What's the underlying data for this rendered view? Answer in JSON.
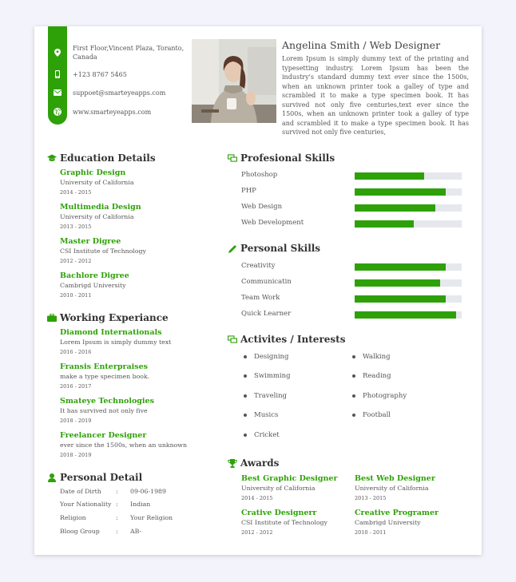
{
  "contact": {
    "address": "First Floor,Vincent Plaza, Toranto, Canada",
    "phone": "+123 8767 5465",
    "email": "suppoet@smarteyeapps.com",
    "website": "www.smarteyeapps.com"
  },
  "profile": {
    "name": "Angelina Smith / Web Designer",
    "bio": "Lorem Ipsum is simply dummy text of the printing and typesetting industry. Lorem Ipsum has been the industry's standard dummy text ever since the 1500s, when an unknown printer took a galley of type and scrambled it to make a type specimen book. It has survived not only five centuries,text ever since the 1500s, when an unknown printer took a galley of type and scrambled it to make a type specimen book. It has survived not only five centuries,"
  },
  "education": {
    "title": "Education Details",
    "items": [
      {
        "title": "Graphic Design",
        "school": "University of California",
        "years": "2014 - 2015"
      },
      {
        "title": "Multimedia Design",
        "school": "University of California",
        "years": "2013 - 2015"
      },
      {
        "title": "Master Digree",
        "school": "CSI Institute of Technology",
        "years": "2012 - 2012"
      },
      {
        "title": "Bachlore Digree",
        "school": "Cambrigd University",
        "years": "2010 - 2011"
      }
    ]
  },
  "experience": {
    "title": "Working Experiance",
    "items": [
      {
        "title": "Diamond Internationals",
        "desc": "Lorem Ipsum is simply dummy text",
        "years": "2016 - 2016"
      },
      {
        "title": "Fransis Enterpraises",
        "desc": "make a type specimen book.",
        "years": "2016 - 2017"
      },
      {
        "title": "Smateye Technologies",
        "desc": "It has survived not only five",
        "years": "2018 - 2019"
      },
      {
        "title": "Freelancer Designer",
        "desc": "ever since the 1500s, when an unknown",
        "years": "2018 - 2019"
      }
    ]
  },
  "personal_detail": {
    "title": "Personal Detail",
    "rows": [
      {
        "key": "Date of Dirth",
        "sep": ":",
        "value": "09-06-1989"
      },
      {
        "key": "Your Nationality",
        "sep": ":",
        "value": "Indian"
      },
      {
        "key": "Religion",
        "sep": ":",
        "value": "Your Religion"
      },
      {
        "key": "Bloog Group",
        "sep": ":",
        "value": "AB-"
      }
    ]
  },
  "professional_skills": {
    "title": "Profesional Skills",
    "items": [
      {
        "label": "Photoshop",
        "level": 0.65
      },
      {
        "label": "PHP",
        "level": 0.85
      },
      {
        "label": "Web Design",
        "level": 0.75
      },
      {
        "label": "Web Development",
        "level": 0.55
      }
    ]
  },
  "personal_skills": {
    "title": "Personal Skills",
    "items": [
      {
        "label": "Creativity",
        "level": 0.85
      },
      {
        "label": "Communicatin",
        "level": 0.8
      },
      {
        "label": "Team Work",
        "level": 0.85
      },
      {
        "label": "Quick Learner",
        "level": 0.95
      }
    ]
  },
  "activities": {
    "title": "Activites / Interests",
    "left": [
      "Designing",
      "Swimming",
      "Traveling",
      "Musics",
      "Cricket"
    ],
    "right": [
      "Walking",
      "Reading",
      "Photography",
      "Football"
    ]
  },
  "awards": {
    "title": "Awards",
    "items": [
      {
        "title": "Best Graphic Designer",
        "school": "University of California",
        "years": "2014 - 2015"
      },
      {
        "title": "Best Web Designer",
        "school": "University of California",
        "years": "2013 - 2015"
      },
      {
        "title": "Crative Designerr",
        "school": "CSI Institute of Technology",
        "years": "2012 - 2012"
      },
      {
        "title": "Creative Programer",
        "school": "Cambrigd University",
        "years": "2010 - 2011"
      }
    ]
  },
  "colors": {
    "accent": "#2ea108",
    "heading": "#333333",
    "text": "#555555",
    "track": "#e6e8ee",
    "background": "#f3f4fb"
  }
}
